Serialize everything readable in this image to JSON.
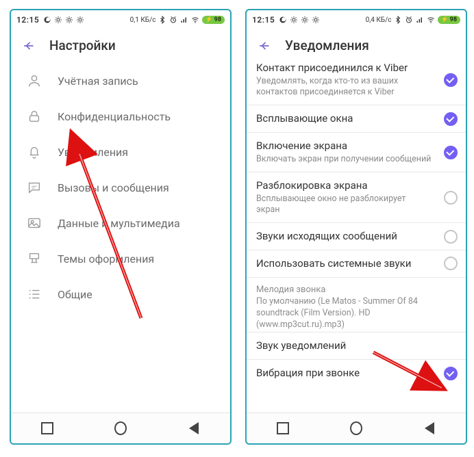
{
  "status": {
    "time": "12:15",
    "data_left": "0,1 КБ/с",
    "data_right": "0,4 КБ/с",
    "battery": "98"
  },
  "left": {
    "title": "Настройки",
    "items": [
      {
        "label": "Учётная запись"
      },
      {
        "label": "Конфиденциальность"
      },
      {
        "label": "Уведомления"
      },
      {
        "label": "Вызовы и сообщения"
      },
      {
        "label": "Данные и мультимедиа"
      },
      {
        "label": "Темы оформления"
      },
      {
        "label": "Общие"
      }
    ]
  },
  "right": {
    "title": "Уведомления",
    "items": [
      {
        "title": "Контакт присоединился к Viber",
        "sub": "Уведомлять, когда кто-то из ваших контактов присоединяется к Viber",
        "on": true
      },
      {
        "title": "Всплывающие окна",
        "sub": "",
        "on": true
      },
      {
        "title": "Включение экрана",
        "sub": "Включать экран при получении сообщений",
        "on": true
      },
      {
        "title": "Разблокировка экрана",
        "sub": "Всплывающее окно не разблокирует экран",
        "on": false
      },
      {
        "title": "Звуки исходящих сообщений",
        "sub": "",
        "on": false
      },
      {
        "title": "Использовать системные звуки",
        "sub": "",
        "on": false
      }
    ],
    "section": {
      "head": "Мелодия звонка",
      "body": "По умолчанию (Le Matos - Summer Of 84 soundtrack (Film Version). HD (www.mp3cut.ru).mp3)"
    },
    "tail": [
      {
        "title": "Звук уведомлений",
        "sub": "",
        "on": null
      },
      {
        "title": "Вибрация при звонке",
        "sub": "",
        "on": true
      }
    ]
  }
}
